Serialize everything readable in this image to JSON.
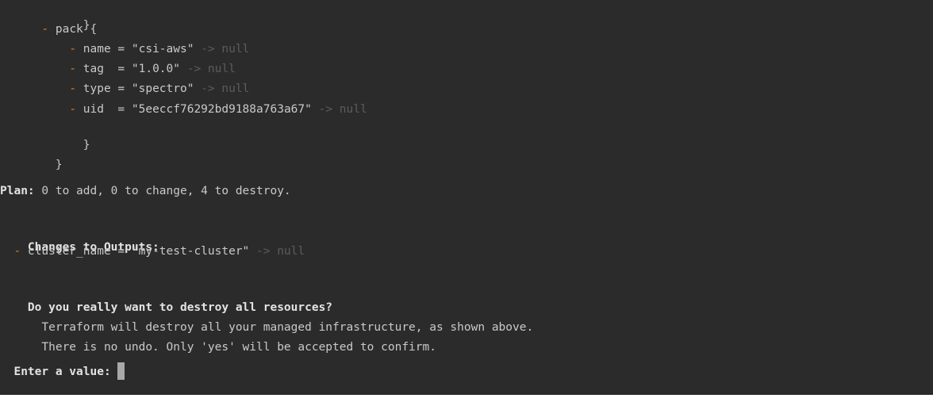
{
  "lines": {
    "l1": {
      "text": "        }"
    },
    "l2": {
      "indent": "      ",
      "minus": "-",
      "text": " pack {"
    },
    "l3": {
      "indent": "          ",
      "minus": "-",
      "text": " name = \"csi-aws\"",
      "arrow": " -> null"
    },
    "l4": {
      "indent": "          ",
      "minus": "-",
      "text": " tag  = \"1.0.0\"",
      "arrow": " -> null"
    },
    "l5": {
      "indent": "          ",
      "minus": "-",
      "text": " type = \"spectro\"",
      "arrow": " -> null"
    },
    "l6": {
      "indent": "          ",
      "minus": "-",
      "text": " uid  = \"5eeccf76292bd9188a763a67\"",
      "arrow": " -> null"
    },
    "l7": {
      "text": "        }"
    },
    "l8": {
      "text": "    }"
    },
    "plan": {
      "label": "Plan:",
      "text": " 0 to add, 0 to change, 4 to destroy."
    },
    "outputs_header": {
      "text": "Changes to Outputs:"
    },
    "output1": {
      "indent": "  ",
      "minus": "-",
      "text": " cluster_name = \"my-test-cluster\"",
      "arrow": " -> null"
    },
    "question": {
      "text": "Do you really want to destroy all resources?"
    },
    "info1": {
      "text": "  Terraform will destroy all your managed infrastructure, as shown above."
    },
    "info2": {
      "text": "  There is no undo. Only 'yes' will be accepted to confirm."
    },
    "prompt": {
      "indent": "  ",
      "label": "Enter a value:",
      "input_value": ""
    }
  },
  "colors": {
    "background": "#2b2b2b",
    "text": "#c9c9c9",
    "minus": "#d0862d",
    "null": "#5c5c5c"
  }
}
